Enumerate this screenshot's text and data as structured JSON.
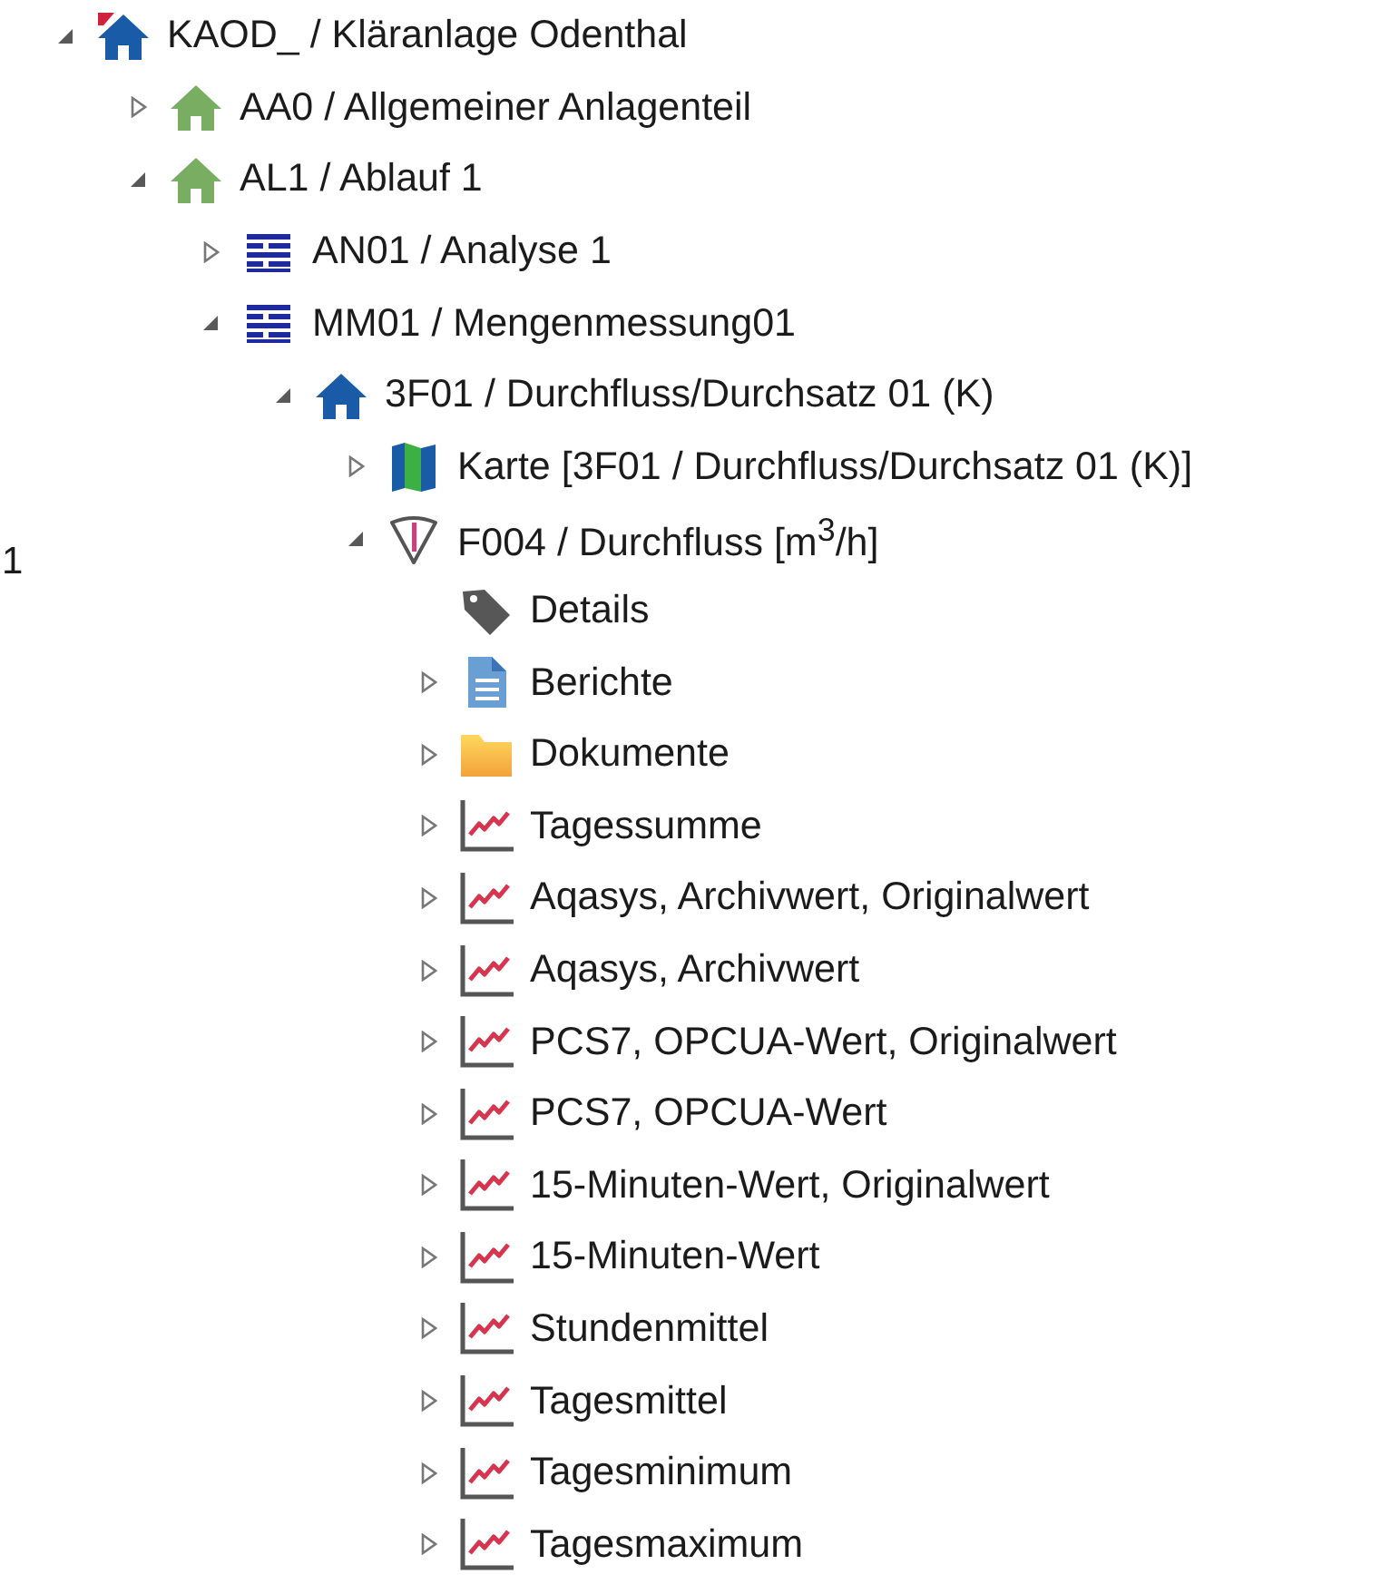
{
  "edge_text": "1",
  "tree": [
    {
      "label": "KAOD_ / Kläranlage Odenthal",
      "kind": "house-red",
      "expandable": true,
      "expanded": true,
      "children": [
        {
          "label": "AA0 / Allgemeiner Anlagenteil",
          "kind": "house-green",
          "expandable": true,
          "expanded": false
        },
        {
          "label": "AL1 / Ablauf 1",
          "kind": "house-green",
          "expandable": true,
          "expanded": true,
          "children": [
            {
              "label": "AN01 / Analyse 1",
              "kind": "list",
              "expandable": true,
              "expanded": false
            },
            {
              "label": "MM01 / Mengenmessung01",
              "kind": "list",
              "expandable": true,
              "expanded": true,
              "children": [
                {
                  "label": "3F01 / Durchfluss/Durchsatz 01 (K)",
                  "kind": "house-blue",
                  "expandable": true,
                  "expanded": true,
                  "children": [
                    {
                      "label": "Karte [3F01 / Durchfluss/Durchsatz 01 (K)]",
                      "kind": "map",
                      "expandable": true,
                      "expanded": false
                    },
                    {
                      "label": "F004 / Durchfluss [m$^{3}$/h]",
                      "kind": "sensor",
                      "expandable": true,
                      "expanded": true,
                      "children": [
                        {
                          "label": "Details",
                          "kind": "tag",
                          "expandable": false
                        },
                        {
                          "label": "Berichte",
                          "kind": "document",
                          "expandable": true,
                          "expanded": false
                        },
                        {
                          "label": "Dokumente",
                          "kind": "folder",
                          "expandable": true,
                          "expanded": false
                        },
                        {
                          "label": "Tagessumme",
                          "kind": "chart",
                          "expandable": true,
                          "expanded": false
                        },
                        {
                          "label": "Aqasys, Archivwert, Originalwert",
                          "kind": "chart",
                          "expandable": true,
                          "expanded": false
                        },
                        {
                          "label": "Aqasys, Archivwert",
                          "kind": "chart",
                          "expandable": true,
                          "expanded": false
                        },
                        {
                          "label": "PCS7, OPCUA-Wert, Originalwert",
                          "kind": "chart",
                          "expandable": true,
                          "expanded": false
                        },
                        {
                          "label": "PCS7, OPCUA-Wert",
                          "kind": "chart",
                          "expandable": true,
                          "expanded": false
                        },
                        {
                          "label": "15-Minuten-Wert, Originalwert",
                          "kind": "chart",
                          "expandable": true,
                          "expanded": false
                        },
                        {
                          "label": "15-Minuten-Wert",
                          "kind": "chart",
                          "expandable": true,
                          "expanded": false
                        },
                        {
                          "label": "Stundenmittel",
                          "kind": "chart",
                          "expandable": true,
                          "expanded": false
                        },
                        {
                          "label": "Tagesmittel",
                          "kind": "chart",
                          "expandable": true,
                          "expanded": false
                        },
                        {
                          "label": "Tagesminimum",
                          "kind": "chart",
                          "expandable": true,
                          "expanded": false
                        },
                        {
                          "label": "Tagesmaximum",
                          "kind": "chart",
                          "expandable": true,
                          "expanded": false
                        }
                      ]
                    }
                  ]
                }
              ]
            }
          ]
        }
      ]
    }
  ]
}
